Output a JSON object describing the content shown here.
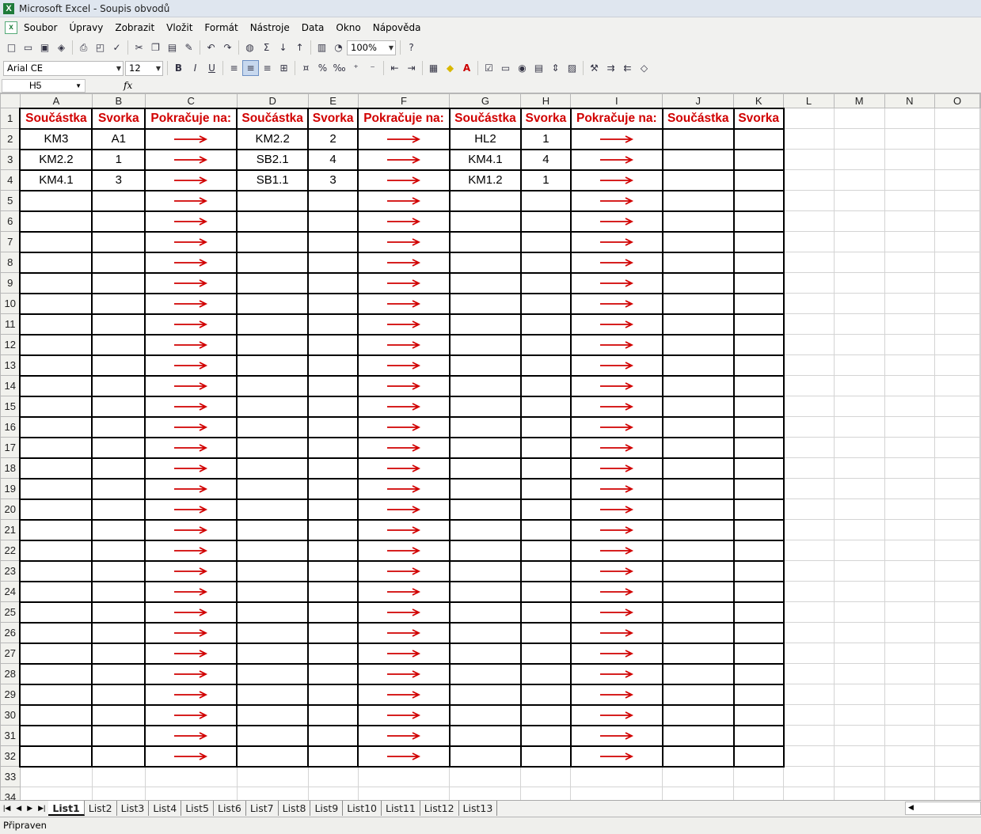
{
  "window": {
    "title": "Microsoft Excel - Soupis obvodů"
  },
  "menu": [
    "Soubor",
    "Úpravy",
    "Zobrazit",
    "Vložit",
    "Formát",
    "Nástroje",
    "Data",
    "Okno",
    "Nápověda"
  ],
  "toolbar": {
    "zoom": "100%",
    "font": "Arial CE",
    "size": "12"
  },
  "namebox": "H5",
  "formula_label": "fx",
  "columns": [
    "A",
    "B",
    "C",
    "D",
    "E",
    "F",
    "G",
    "H",
    "I",
    "J",
    "K",
    "L",
    "M",
    "N",
    "O"
  ],
  "rows": [
    "1",
    "2",
    "3",
    "4",
    "5",
    "6",
    "7",
    "8",
    "9",
    "10",
    "11",
    "12",
    "13",
    "14",
    "15",
    "16",
    "17",
    "18",
    "19",
    "20",
    "21",
    "22",
    "23",
    "24",
    "25",
    "26",
    "27",
    "28",
    "29",
    "30",
    "31",
    "32",
    "33",
    "34"
  ],
  "headers": [
    "Součástka",
    "Svorka",
    "Pokračuje na:",
    "Součástka",
    "Svorka",
    "Pokračuje na:",
    "Součástka",
    "Svorka",
    "Pokračuje na:",
    "Součástka",
    "Svorka"
  ],
  "data_rows": [
    [
      "KM3",
      "A1",
      "KM2.2",
      "2",
      "HL2",
      "1"
    ],
    [
      "KM2.2",
      "1",
      "SB2.1",
      "4",
      "KM4.1",
      "4"
    ],
    [
      "KM4.1",
      "3",
      "SB1.1",
      "3",
      "KM1.2",
      "1"
    ]
  ],
  "colors": {
    "accent_red": "#d10000"
  },
  "sheets": [
    "List1",
    "List2",
    "List3",
    "List4",
    "List5",
    "List6",
    "List7",
    "List8",
    "List9",
    "List10",
    "List11",
    "List12",
    "List13"
  ],
  "status": "Připraven"
}
